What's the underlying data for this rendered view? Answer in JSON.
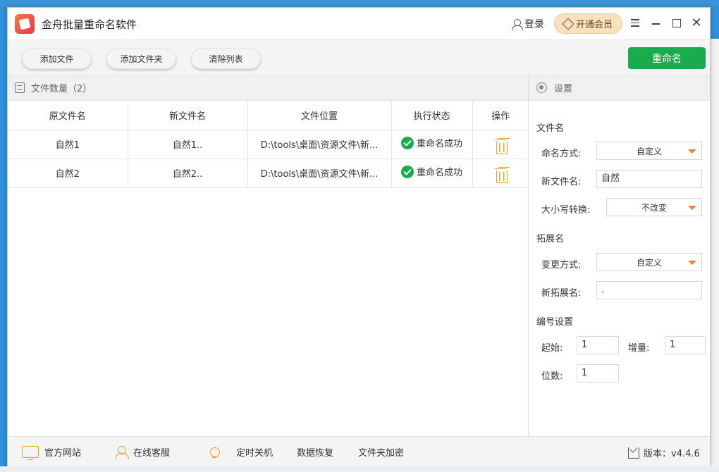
{
  "app": {
    "title": "金舟批量重命名软件"
  },
  "header": {
    "login_label": "登录",
    "vip_label": "开通会员"
  },
  "toolbar": {
    "add_file_label": "添加文件",
    "add_folder_label": "添加文件夹",
    "clear_list_label": "清除列表",
    "rename_label": "重命名"
  },
  "file_list": {
    "count_label": "文件数量（2）",
    "columns": [
      "原文件名",
      "新文件名",
      "文件位置",
      "执行状态",
      "操作"
    ],
    "rows": [
      {
        "original": "自然1",
        "new": "自然1..",
        "location": "D:\\tools\\桌面\\资源文件\\新...",
        "status": "重命名成功"
      },
      {
        "original": "自然2",
        "new": "自然2..",
        "location": "D:\\tools\\桌面\\资源文件\\新...",
        "status": "重命名成功"
      }
    ]
  },
  "settings": {
    "title": "设置",
    "filename_section": "文件名",
    "naming_mode_label": "命名方式:",
    "naming_mode_value": "自定义",
    "new_filename_label": "新文件名:",
    "new_filename_value": "自然",
    "case_label": "大小写转换:",
    "case_value": "不改变",
    "ext_section": "拓展名",
    "change_mode_label": "变更方式:",
    "change_mode_value": "自定义",
    "new_ext_label": "新拓展名:",
    "new_ext_value": ".",
    "numbering_section": "编号设置",
    "start_label": "起始:",
    "start_value": "1",
    "increment_label": "增量:",
    "increment_value": "1",
    "digits_label": "位数:",
    "digits_value": "1"
  },
  "footer": {
    "website_label": "官方网站",
    "service_label": "在线客服",
    "shutdown_label": "定时关机",
    "recovery_label": "数据恢复",
    "encrypt_label": "文件夹加密",
    "version_label": "版本：v4.4.6"
  },
  "colors": {
    "primary_green": "#1aab4c",
    "accent_orange": "#f0a020",
    "vip_gold": "#f7e1c0"
  },
  "icons": [
    "app-logo",
    "user-icon",
    "diamond-icon",
    "menu-icon",
    "minimize-icon",
    "maximize-icon",
    "close-icon",
    "doc-icon",
    "check-circle-icon",
    "trash-icon",
    "radio-icon",
    "dropdown-caret-icon",
    "monitor-icon",
    "service-icon",
    "bulb-icon",
    "download-icon"
  ]
}
